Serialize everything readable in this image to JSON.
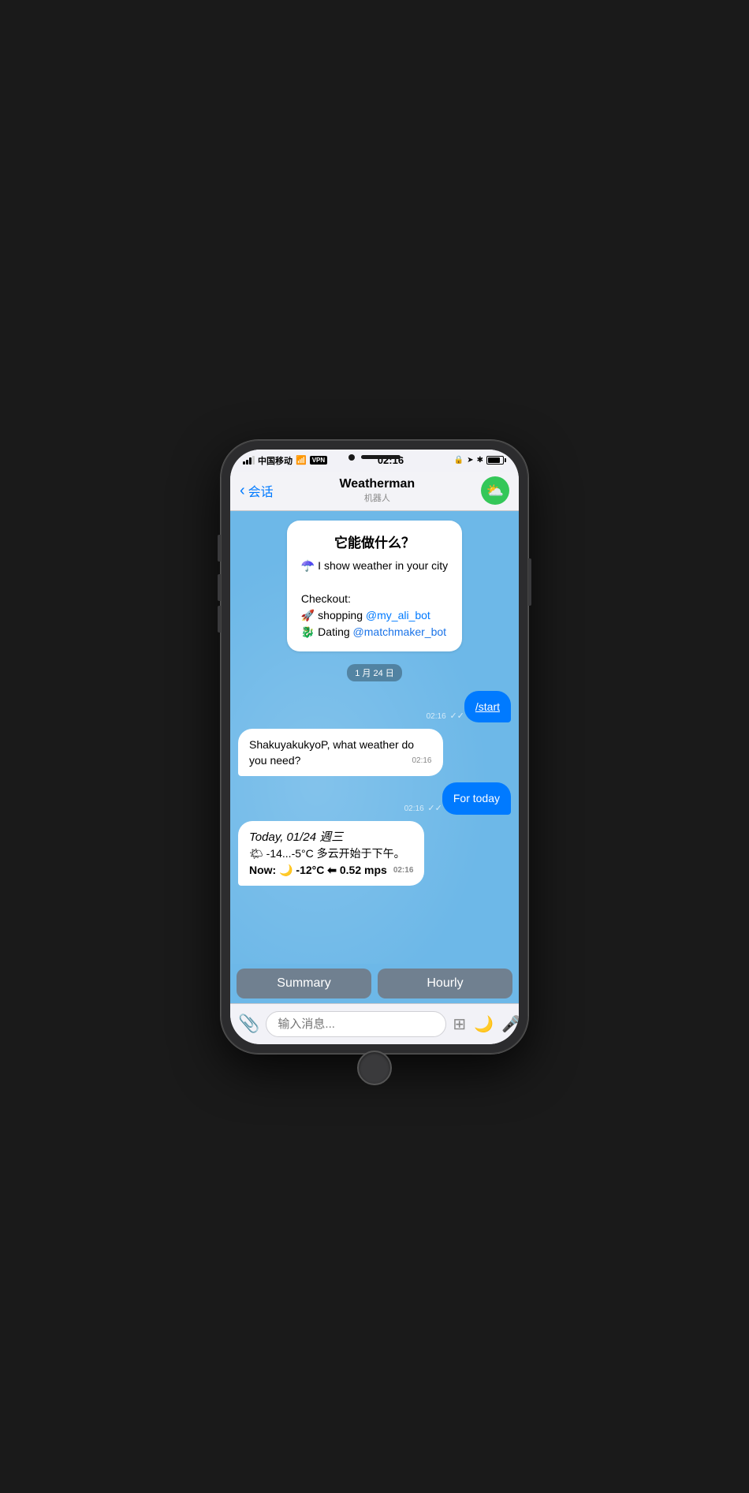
{
  "phone": {
    "status_bar": {
      "carrier": "中国移动",
      "wifi": "WiFi",
      "vpn": "VPN",
      "time": "02:16",
      "lock_icon": "🔒",
      "location_icon": "➤",
      "bluetooth_icon": "✱"
    },
    "nav": {
      "back_label": "会话",
      "title": "Weatherman",
      "subtitle": "机器人"
    },
    "chat": {
      "intro_title": "它能做什么？",
      "intro_line1": "☂️ I show weather in your city",
      "intro_checkout": "Checkout:",
      "intro_shopping": "🚀 shopping",
      "intro_shopping_link": "@my_ali_bot",
      "intro_dating": "🐉 Dating",
      "intro_dating_link": "@matchmaker_bot",
      "date_divider": "1 月 24 日",
      "message_start": "/start",
      "time_start": "02:16",
      "message_bot1": "ShakuyakukyoP, what weather do you need?",
      "time_bot1": "02:16",
      "message_fortoday": "For today",
      "time_fortoday": "02:16",
      "message_weather_line1": "Today, 01/24 週三",
      "message_weather_line2": "🌤 -14...-5°C 多云开始于下午。",
      "message_weather_line3": "Now: 🌙 -12°C ⬅ 0.52 mps",
      "time_weather": "02:16"
    },
    "quick_replies": {
      "summary": "Summary",
      "hourly": "Hourly"
    },
    "input_bar": {
      "placeholder": "输入消息..."
    }
  }
}
